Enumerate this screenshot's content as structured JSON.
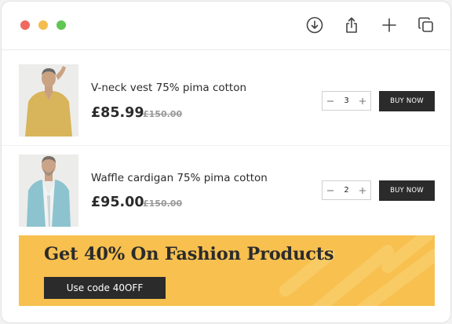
{
  "window": {
    "controls": [
      "close",
      "minimize",
      "maximize"
    ],
    "toolbar_icons": [
      "download-icon",
      "share-icon",
      "plus-icon",
      "copy-icon"
    ]
  },
  "products": [
    {
      "name": "V-neck vest 75% pima cotton",
      "price": "£85.99",
      "old_price": "£150.00",
      "quantity": "3",
      "buy_label": "BUY NOW"
    },
    {
      "name": "Waffle cardigan 75% pima cotton",
      "price": "£95.00",
      "old_price": "£150.00",
      "quantity": "2",
      "buy_label": "BUY NOW"
    }
  ],
  "banner": {
    "title": "Get 40% On Fashion Products",
    "code_label": "Use code 40OFF"
  },
  "colors": {
    "accent": "#f7c04f",
    "dark": "#2b2b2b",
    "close": "#ee6a5f",
    "minimize": "#f5bd4f",
    "maximize": "#61c554"
  }
}
